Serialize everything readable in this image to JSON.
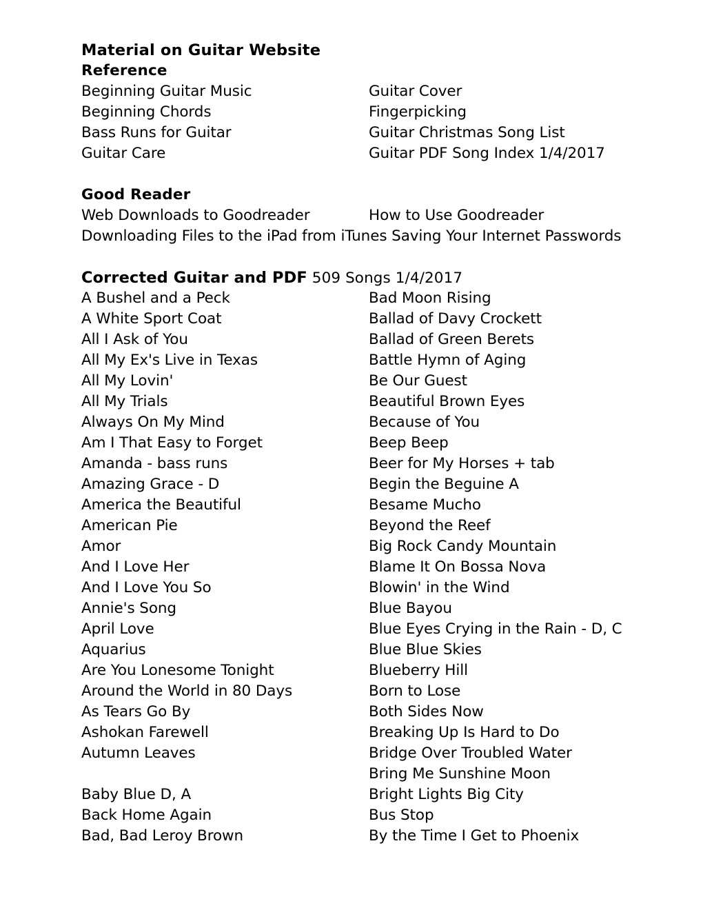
{
  "document": {
    "title": "Material on Guitar Website",
    "page_background": "#ffffff",
    "text_color": "#000000"
  },
  "reference_section": {
    "heading": "Reference",
    "rows": [
      {
        "left": "Beginning Guitar Music",
        "right": "Guitar Cover"
      },
      {
        "left": "Beginning Chords",
        "right": "Fingerpicking"
      },
      {
        "left": "Bass Runs for Guitar",
        "right": "Guitar Christmas Song List"
      },
      {
        "left": "Guitar Care",
        "right": "Guitar PDF Song Index 1/4/2017"
      }
    ]
  },
  "good_reader_section": {
    "heading": "Good Reader",
    "rows": [
      {
        "left": "Web Downloads to Goodreader",
        "right": "How to Use Goodreader",
        "overflow": false
      },
      {
        "left": "Downloading Files to the iPad from iTunes ",
        "right": "Saving Your Internet Passwords",
        "overflow": true
      }
    ]
  },
  "songs_section": {
    "heading_bold": "Corrected Guitar and PDF",
    "heading_normal": " 509 Songs 1/4/2017",
    "song_count": "509",
    "date": "1/4/2017",
    "left_column": [
      "A Bushel and a Peck",
      "A White Sport Coat",
      "All I Ask of You",
      "All My Ex's Live in Texas",
      "All My Lovin'",
      "All My Trials",
      "Always On My Mind",
      "Am I That Easy to Forget",
      "Amanda - bass runs",
      "Amazing Grace - D",
      "America the Beautiful",
      "American Pie",
      "Amor",
      "And I Love Her",
      "And I Love You So",
      "Annie's Song",
      "April Love",
      "Aquarius",
      "Are You Lonesome Tonight",
      "Around the World in 80 Days",
      "As Tears Go By",
      "Ashokan Farewell",
      "Autumn Leaves",
      "",
      "Baby Blue D, A",
      "Back Home Again",
      "Bad, Bad Leroy Brown"
    ],
    "right_column": [
      "Bad Moon Rising",
      "Ballad of Davy Crockett",
      "Ballad of Green Berets",
      "Battle Hymn of Aging",
      "Be Our Guest",
      "Beautiful Brown Eyes",
      "Because of You",
      "Beep Beep",
      "Beer for My Horses + tab",
      "Begin the Beguine A",
      "Besame Mucho",
      "Beyond the Reef",
      "Big Rock Candy Mountain",
      "Blame It On Bossa Nova",
      "Blowin' in the Wind",
      "Blue Bayou",
      "Blue Eyes Crying in the Rain - D, C",
      "Blue Blue Skies",
      "Blueberry Hill",
      "Born to Lose",
      "Both Sides Now",
      "Breaking Up Is Hard to Do",
      "Bridge Over Troubled Water",
      "Bring Me Sunshine Moon",
      "Bright Lights Big City",
      "Bus Stop",
      "By the Time I Get to Phoenix"
    ]
  }
}
